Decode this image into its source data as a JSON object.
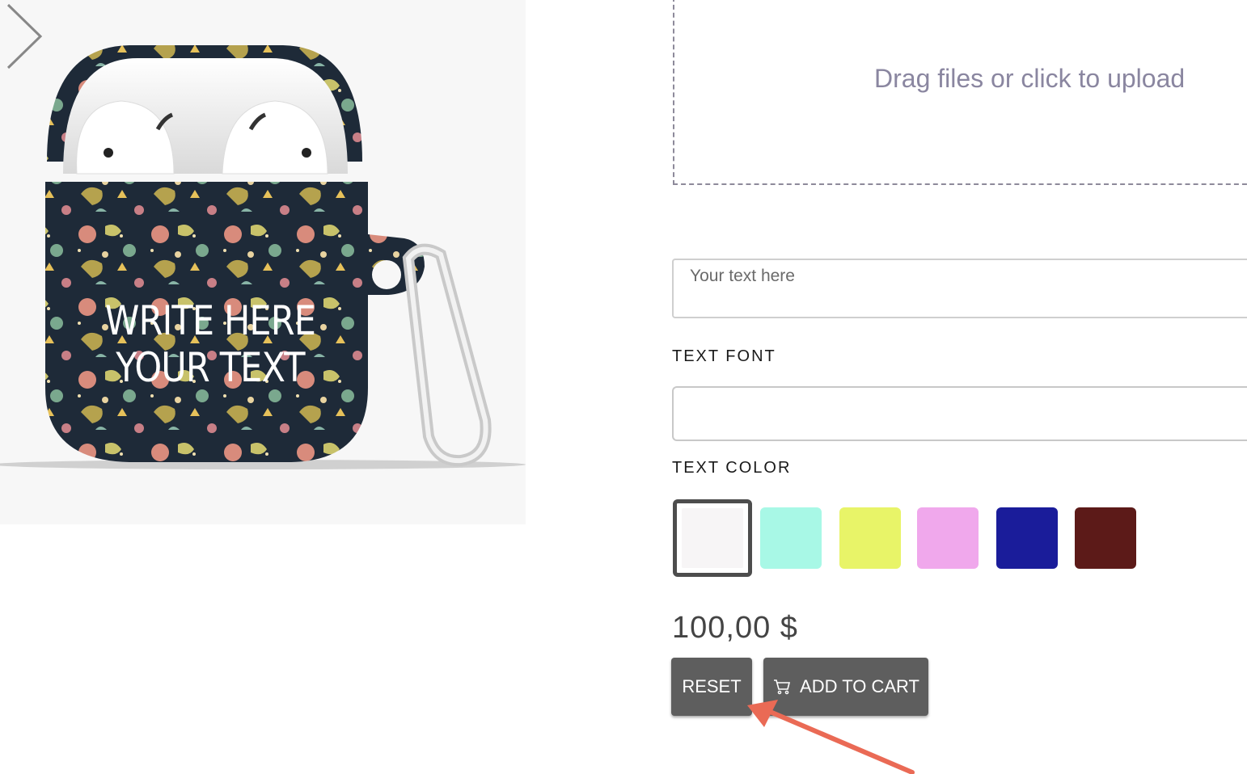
{
  "product": {
    "preview_line1": "WRITE HERE",
    "preview_line2": "YOUR TEXT"
  },
  "gallery": {
    "next_icon": "chevron-right-icon"
  },
  "upload": {
    "text": "Drag files or click to upload"
  },
  "text_input": {
    "placeholder": "Your text here",
    "value": ""
  },
  "text_font": {
    "label": "TEXT FONT",
    "selected": ""
  },
  "text_color": {
    "label": "TEXT COLOR",
    "options": [
      "#f7f5f6",
      "#a8f8e6",
      "#e8f468",
      "#f0a8ec",
      "#1a1c9a",
      "#5c1a18"
    ],
    "selected_index": 0
  },
  "price": "100,00 $",
  "buttons": {
    "reset": "RESET",
    "add_to_cart": "ADD TO CART",
    "cart_icon": "cart-icon"
  },
  "colors": {
    "button_bg": "#5e5e5e",
    "annotation_arrow": "#ea6a55"
  }
}
